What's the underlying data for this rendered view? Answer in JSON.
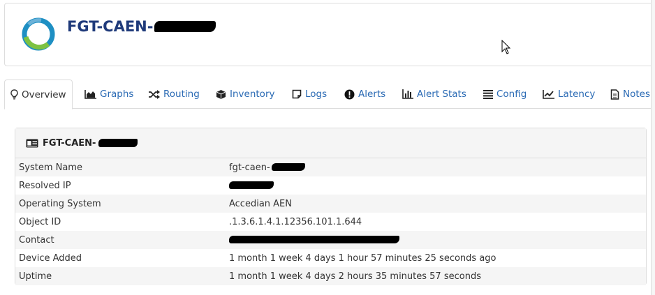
{
  "device": {
    "title": "FGT-CAEN-"
  },
  "tabs": [
    {
      "label": "Overview",
      "icon": "lightbulb-icon",
      "active": true
    },
    {
      "label": "Graphs",
      "icon": "area-chart-icon"
    },
    {
      "label": "Routing",
      "icon": "shuffle-icon"
    },
    {
      "label": "Inventory",
      "icon": "cube-icon"
    },
    {
      "label": "Logs",
      "icon": "sticky-note-icon"
    },
    {
      "label": "Alerts",
      "icon": "exclamation-circle-icon"
    },
    {
      "label": "Alert Stats",
      "icon": "bar-chart-icon"
    },
    {
      "label": "Config",
      "icon": "align-justify-icon"
    },
    {
      "label": "Latency",
      "icon": "line-chart-icon"
    },
    {
      "label": "Notes",
      "icon": "file-text-icon"
    }
  ],
  "overview": {
    "card_title": "FGT-CAEN-",
    "rows": [
      {
        "label": "System Name",
        "value": "fgt-caen-"
      },
      {
        "label": "Resolved IP",
        "value": ""
      },
      {
        "label": "Operating System",
        "value": "Accedian AEN"
      },
      {
        "label": "Object ID",
        "value": ".1.3.6.1.4.1.12356.101.1.644"
      },
      {
        "label": "Contact",
        "value": ""
      },
      {
        "label": "Device Added",
        "value": "1 month 1 week 4 days 1 hour 57 minutes 25 seconds ago"
      },
      {
        "label": "Uptime",
        "value": "1 month 1 week 4 days 2 hours 35 minutes 57 seconds"
      }
    ]
  }
}
